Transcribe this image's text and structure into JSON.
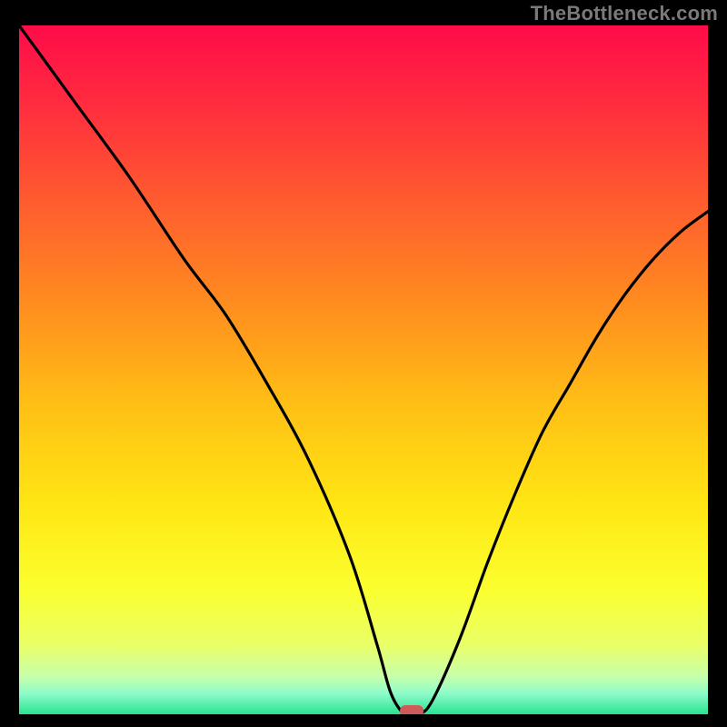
{
  "watermark": "TheBottleneck.com",
  "chart_data": {
    "type": "line",
    "title": "",
    "xlabel": "",
    "ylabel": "",
    "xlim": [
      0,
      100
    ],
    "ylim": [
      0,
      100
    ],
    "series": [
      {
        "name": "bottleneck-curve",
        "x": [
          0,
          8,
          16,
          24,
          30,
          36,
          42,
          48,
          52,
          54,
          56,
          58,
          60,
          64,
          68,
          72,
          76,
          80,
          84,
          88,
          92,
          96,
          100
        ],
        "values": [
          100,
          89,
          78,
          66,
          58,
          48,
          37,
          23,
          10,
          3,
          0,
          0,
          2,
          11,
          22,
          32,
          41,
          48,
          55,
          61,
          66,
          70,
          73
        ]
      }
    ],
    "marker": {
      "x": 57,
      "y": 0,
      "color": "#cf5a5a"
    },
    "background_gradient": {
      "stops": [
        {
          "offset": 0.0,
          "color": "#ff0b49"
        },
        {
          "offset": 0.12,
          "color": "#ff2e3e"
        },
        {
          "offset": 0.25,
          "color": "#ff5a2f"
        },
        {
          "offset": 0.4,
          "color": "#ff8b1f"
        },
        {
          "offset": 0.55,
          "color": "#ffbf15"
        },
        {
          "offset": 0.7,
          "color": "#ffe714"
        },
        {
          "offset": 0.82,
          "color": "#fbff2f"
        },
        {
          "offset": 0.9,
          "color": "#e9ff68"
        },
        {
          "offset": 0.945,
          "color": "#c7ffaa"
        },
        {
          "offset": 0.97,
          "color": "#8dfccb"
        },
        {
          "offset": 1.0,
          "color": "#29e38f"
        }
      ]
    }
  }
}
